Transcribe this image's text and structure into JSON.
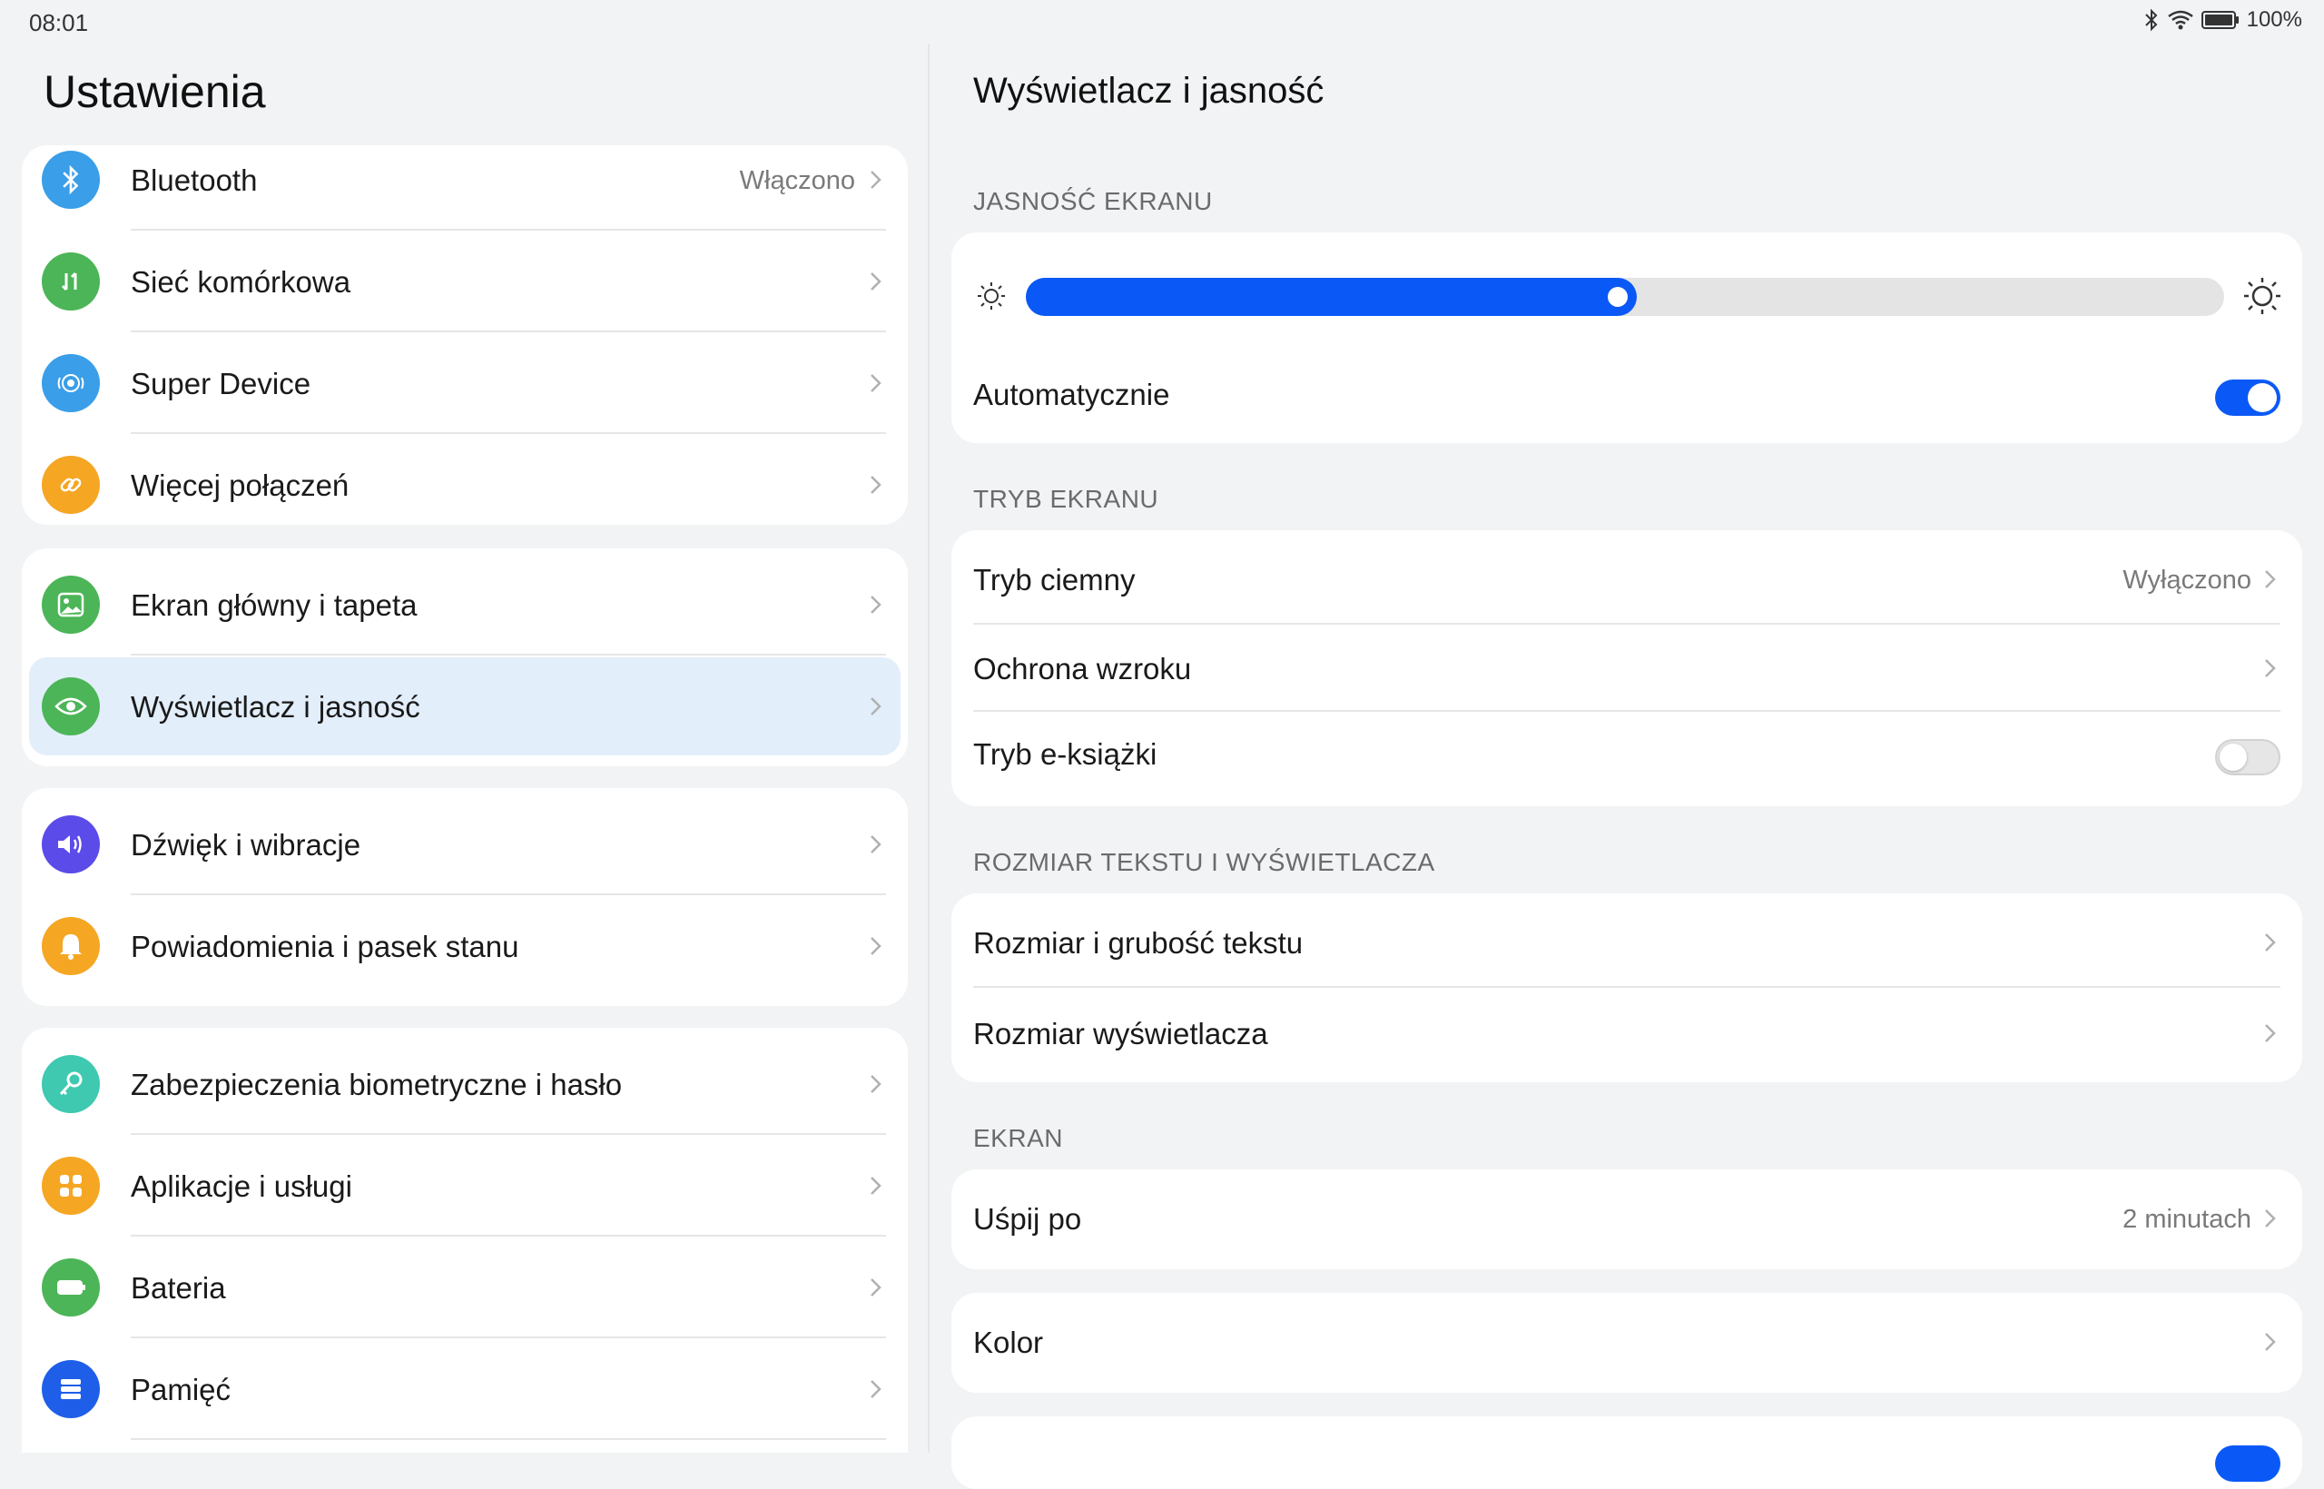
{
  "status_bar": {
    "time": "08:01",
    "battery": "100%",
    "icons": [
      "bluetooth-icon",
      "wifi-icon",
      "battery-icon"
    ]
  },
  "left_panel": {
    "title": "Ustawienia",
    "groups": [
      {
        "items": [
          {
            "label": "Bluetooth",
            "value": "Włączono",
            "icon": "bluetooth-icon",
            "color": "#3a9ee8"
          },
          {
            "label": "Sieć komórkowa",
            "value": "",
            "icon": "mobile-data-icon",
            "color": "#4cb557"
          },
          {
            "label": "Super Device",
            "value": "",
            "icon": "super-device-icon",
            "color": "#3a9ee8"
          },
          {
            "label": "Więcej połączeń",
            "value": "",
            "icon": "link-icon",
            "color": "#f5a623"
          }
        ]
      },
      {
        "items": [
          {
            "label": "Ekran główny i tapeta",
            "value": "",
            "icon": "wallpaper-icon",
            "color": "#4cb557"
          },
          {
            "label": "Wyświetlacz i jasność",
            "value": "",
            "icon": "eye-icon",
            "color": "#4cb557",
            "selected": true
          }
        ]
      },
      {
        "items": [
          {
            "label": "Dźwięk i wibracje",
            "value": "",
            "icon": "volume-icon",
            "color": "#5b4be8"
          },
          {
            "label": "Powiadomienia i pasek stanu",
            "value": "",
            "icon": "bell-icon",
            "color": "#f5a623"
          }
        ]
      },
      {
        "items": [
          {
            "label": "Zabezpieczenia biometryczne i hasło",
            "value": "",
            "icon": "key-icon",
            "color": "#3ec9b0"
          },
          {
            "label": "Aplikacje i usługi",
            "value": "",
            "icon": "apps-icon",
            "color": "#f5a623"
          },
          {
            "label": "Bateria",
            "value": "",
            "icon": "battery-icon",
            "color": "#4cb557"
          },
          {
            "label": "Pamięć",
            "value": "",
            "icon": "storage-icon",
            "color": "#1f5ee8"
          }
        ]
      }
    ]
  },
  "right_panel": {
    "title": "Wyświetlacz i jasność",
    "sections": {
      "brightness": {
        "label": "JASNOŚĆ EKRANU",
        "level_percent": 51,
        "auto_label": "Automatycznie",
        "auto_on": true
      },
      "screen_mode": {
        "label": "TRYB EKRANU",
        "dark_mode_label": "Tryb ciemny",
        "dark_mode_value": "Wyłączono",
        "eye_comfort_label": "Ochrona wzroku",
        "ebook_label": "Tryb e-książki",
        "ebook_on": false
      },
      "text_size": {
        "label": "ROZMIAR TEKSTU I WYŚWIETLACZA",
        "text_size_label": "Rozmiar i grubość tekstu",
        "display_size_label": "Rozmiar wyświetlacza"
      },
      "screen": {
        "label": "EKRAN",
        "sleep_label": "Uśpij po",
        "sleep_value": "2 minutach"
      },
      "color": {
        "label": "Kolor"
      }
    }
  },
  "colors": {
    "accent": "#0a59f7",
    "selected_row_bg": "#e3eefb",
    "background": "#f1f3f5"
  }
}
